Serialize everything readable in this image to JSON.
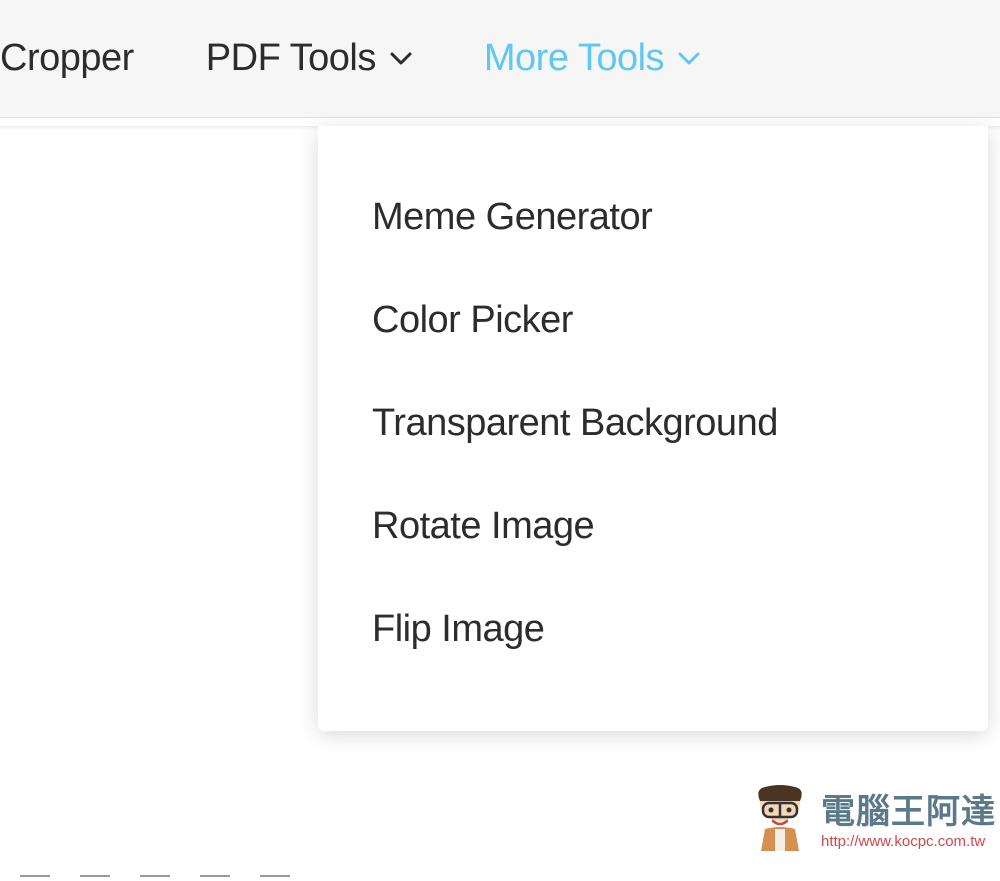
{
  "nav": {
    "items": [
      {
        "label": "Cropper",
        "has_chevron": false,
        "active": false
      },
      {
        "label": "PDF Tools",
        "has_chevron": true,
        "active": false
      },
      {
        "label": "More Tools",
        "has_chevron": true,
        "active": true
      }
    ]
  },
  "dropdown": {
    "items": [
      {
        "label": "Meme Generator"
      },
      {
        "label": "Color Picker"
      },
      {
        "label": "Transparent Background"
      },
      {
        "label": "Rotate Image"
      },
      {
        "label": "Flip Image"
      }
    ]
  },
  "watermark": {
    "title": "電腦王阿達",
    "url": "http://www.kocpc.com.tw"
  },
  "colors": {
    "nav_bg": "#f6f6f6",
    "nav_text": "#2c2c2c",
    "nav_active": "#5ec8f2",
    "dropdown_text": "#2c2c2c",
    "watermark_title": "#5a7a8a",
    "watermark_url": "#d04848"
  }
}
